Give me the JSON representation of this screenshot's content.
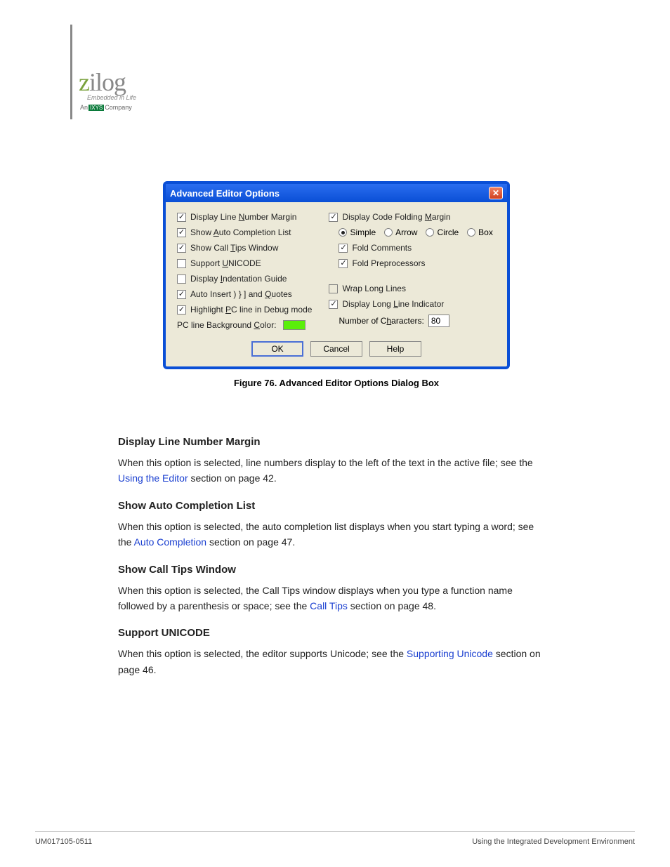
{
  "logo": {
    "text": "zilog",
    "sub": "Embedded in Life",
    "company_prefix": "An",
    "company_box": "IXYS",
    "company_suffix": "Company"
  },
  "dialog": {
    "title": "Advanced Editor Options",
    "left": {
      "display_line_number": "Display Line Number Margin",
      "show_auto_completion": "Show Auto Completion List",
      "show_call_tips": "Show Call Tips Window",
      "support_unicode": "Support UNICODE",
      "display_indentation": "Display Indentation Guide",
      "auto_insert": "Auto Insert )  }  ] and Quotes",
      "highlight_pc": "Highlight PC line in Debug mode",
      "pc_line_bg": "PC line Background Color:"
    },
    "right": {
      "display_code_folding": "Display Code Folding Margin",
      "radio_simple": "Simple",
      "radio_arrow": "Arrow",
      "radio_circle": "Circle",
      "radio_box": "Box",
      "fold_comments": "Fold Comments",
      "fold_preprocessors": "Fold Preprocessors",
      "wrap_long_lines": "Wrap Long Lines",
      "display_long_line": "Display Long Line Indicator",
      "num_chars_label": "Number of Characters:",
      "num_chars_value": "80"
    },
    "buttons": {
      "ok": "OK",
      "cancel": "Cancel",
      "help": "Help"
    }
  },
  "figure_caption": "Figure 76. Advanced Editor Options Dialog Box",
  "content": {
    "heading_dlnm": "Display Line Number Margin",
    "para_dlnm_1": "When this option is selected, line numbers display to the left of the text in the active file; see the ",
    "para_dlnm_link": "Using the Editor",
    "para_dlnm_2": " section on page 42.",
    "heading_sacl": "Show Auto Completion List",
    "para_sacl_1": "When this option is selected, the auto completion list displays when you start typing a word; see the ",
    "para_sacl_link": "Auto Completion",
    "para_sacl_2": " section on page 47.",
    "heading_sctw": "Show Call Tips Window",
    "para_sctw_1": "When this option is selected, the Call Tips window displays when you type a function name followed by a parenthesis or space; see the ",
    "para_sctw_link": "Call Tips",
    "para_sctw_2": " section on page 48.",
    "heading_su": "Support UNICODE",
    "para_su_1": "When this option is selected, the editor supports Unicode; see the ",
    "para_su_link": "Supporting Unicode",
    "para_su_2": " section on page 46."
  },
  "footer": {
    "left": "UM017105-0511",
    "right": "Using the Integrated Development Environment"
  }
}
